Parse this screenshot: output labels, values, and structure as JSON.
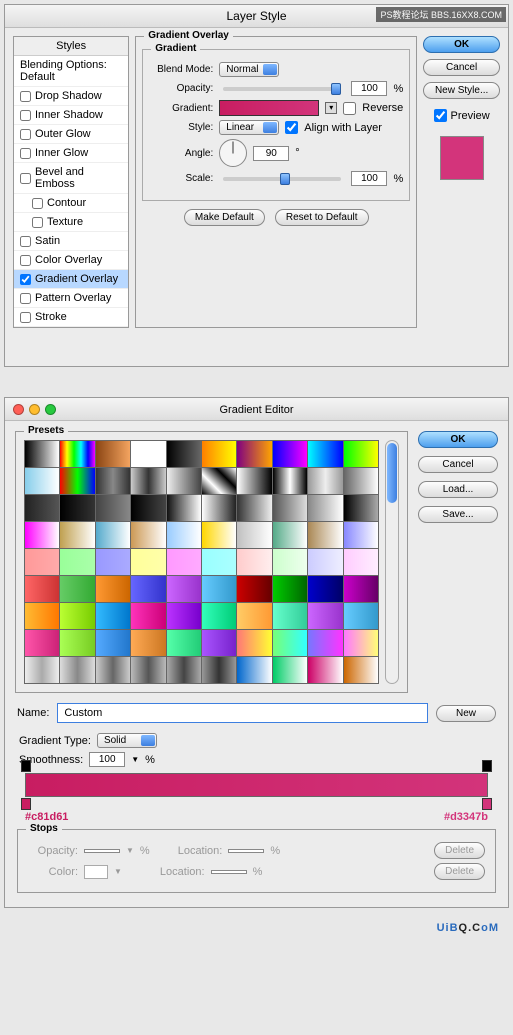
{
  "watermark": "PS教程论坛\nBBS.16XX8.COM",
  "dialog1": {
    "title": "Layer Style",
    "styles_header": "Styles",
    "blending_header": "Blending Options: Default",
    "items": [
      {
        "label": "Drop Shadow",
        "checked": false,
        "sel": false
      },
      {
        "label": "Inner Shadow",
        "checked": false,
        "sel": false
      },
      {
        "label": "Outer Glow",
        "checked": false,
        "sel": false
      },
      {
        "label": "Inner Glow",
        "checked": false,
        "sel": false
      },
      {
        "label": "Bevel and Emboss",
        "checked": false,
        "sel": false
      },
      {
        "label": "Contour",
        "checked": false,
        "sel": false,
        "sub": true
      },
      {
        "label": "Texture",
        "checked": false,
        "sel": false,
        "sub": true
      },
      {
        "label": "Satin",
        "checked": false,
        "sel": false
      },
      {
        "label": "Color Overlay",
        "checked": false,
        "sel": false
      },
      {
        "label": "Gradient Overlay",
        "checked": true,
        "sel": true
      },
      {
        "label": "Pattern Overlay",
        "checked": false,
        "sel": false
      },
      {
        "label": "Stroke",
        "checked": false,
        "sel": false
      }
    ],
    "group_title": "Gradient Overlay",
    "inner_title": "Gradient",
    "blend_mode_label": "Blend Mode:",
    "blend_mode": "Normal",
    "opacity_label": "Opacity:",
    "opacity": "100",
    "pct": "%",
    "gradient_label": "Gradient:",
    "reverse_label": "Reverse",
    "reverse": false,
    "style_label": "Style:",
    "style": "Linear",
    "align_label": "Align with Layer",
    "align": true,
    "angle_label": "Angle:",
    "angle": "90",
    "deg": "°",
    "scale_label": "Scale:",
    "scale": "100",
    "make_default": "Make Default",
    "reset_default": "Reset to Default",
    "ok": "OK",
    "cancel": "Cancel",
    "new_style": "New Style...",
    "preview_label": "Preview",
    "preview": true
  },
  "dialog2": {
    "title": "Gradient Editor",
    "presets_label": "Presets",
    "ok": "OK",
    "cancel": "Cancel",
    "load": "Load...",
    "save": "Save...",
    "name_label": "Name:",
    "name": "Custom",
    "new": "New",
    "grad_type_label": "Gradient Type:",
    "grad_type": "Solid",
    "smooth_label": "Smoothness:",
    "smooth": "100",
    "pct": "%",
    "hex_left": "#c81d61",
    "hex_right": "#d3347b",
    "stops_label": "Stops",
    "opacity_label": "Opacity:",
    "color_label": "Color:",
    "location_label": "Location:",
    "delete": "Delete",
    "preset_colors": [
      "linear-gradient(90deg,#000,#fff)",
      "linear-gradient(90deg,#ff0000,#ffff00,#00ff00,#00ffff,#0000ff,#ff00ff)",
      "linear-gradient(90deg,#8B4513,#F4A460)",
      "linear-gradient(90deg,#fff,#fff)",
      "linear-gradient(90deg,#000,transparent)",
      "linear-gradient(90deg,#ff7f00,#ffff00)",
      "linear-gradient(90deg,#800080,#ffa500)",
      "linear-gradient(90deg,#00f,#f0f)",
      "linear-gradient(90deg,#0ff,#00f)",
      "linear-gradient(90deg,#0f0,#ff0)",
      "linear-gradient(90deg,#87ceeb,#fff)",
      "linear-gradient(90deg,#f00,#0f0,#00f)",
      "linear-gradient(90deg,#333,#888,#333)",
      "linear-gradient(90deg,#ccc,#333,#ccc)",
      "linear-gradient(90deg,#eee,#444)",
      "linear-gradient(45deg,#000,#fff,#000,#fff)",
      "linear-gradient(90deg,#fff,#000)",
      "linear-gradient(90deg,#000,#fff,#000)",
      "linear-gradient(90deg,#999,#eee,#999)",
      "linear-gradient(90deg,#666,#fff)",
      "linear-gradient(90deg,#222,#555)",
      "linear-gradient(90deg,#000,#333)",
      "linear-gradient(90deg,#444,#888)",
      "linear-gradient(90deg,#000,#444)",
      "linear-gradient(90deg,#111,#fff)",
      "linear-gradient(90deg,#fff,#222)",
      "linear-gradient(90deg,#333,#eee)",
      "linear-gradient(90deg,#555,#ddd)",
      "linear-gradient(90deg,#888,#fff)",
      "linear-gradient(90deg,#000,#aaa)",
      "linear-gradient(90deg,#f0f,#fff)",
      "linear-gradient(90deg,#c0a050,#fff)",
      "linear-gradient(90deg,#5ac,#fff)",
      "linear-gradient(90deg,#c95,#fff)",
      "linear-gradient(90deg,#9cf,#fff)",
      "linear-gradient(90deg,#ffd700,#fff)",
      "linear-gradient(90deg,#c0c0c0,#fff)",
      "linear-gradient(90deg,#5a8,#fff)",
      "linear-gradient(90deg,#a85,#fff)",
      "linear-gradient(90deg,#88f,#fff)",
      "linear-gradient(90deg,#f99,#faa)",
      "linear-gradient(90deg,#9f9,#afa)",
      "linear-gradient(90deg,#99f,#aaf)",
      "linear-gradient(90deg,#ff9,#ffa)",
      "linear-gradient(90deg,#f9f,#faf)",
      "linear-gradient(90deg,#9ff,#aff)",
      "linear-gradient(90deg,#fcc,#fee)",
      "linear-gradient(90deg,#cfc,#efe)",
      "linear-gradient(90deg,#ccf,#eef)",
      "linear-gradient(90deg,#fcf,#fef)",
      "linear-gradient(90deg,#f66,#c33)",
      "linear-gradient(90deg,#6c6,#3a3)",
      "linear-gradient(90deg,#f93,#c60)",
      "linear-gradient(90deg,#66f,#33c)",
      "linear-gradient(90deg,#c6f,#93c)",
      "linear-gradient(90deg,#6cf,#39c)",
      "linear-gradient(90deg,#c00,#600)",
      "linear-gradient(90deg,#0c0,#060)",
      "linear-gradient(90deg,#00c,#006)",
      "linear-gradient(90deg,#c0c,#606)",
      "linear-gradient(90deg,#fb3,#f70)",
      "linear-gradient(90deg,#bf3,#7c0)",
      "linear-gradient(90deg,#3bf,#07c)",
      "linear-gradient(90deg,#f3b,#c07)",
      "linear-gradient(90deg,#b3f,#70c)",
      "linear-gradient(90deg,#3fb,#0c7)",
      "linear-gradient(90deg,#fc6,#f93)",
      "linear-gradient(90deg,#6fc,#3c9)",
      "linear-gradient(90deg,#c6f,#93c)",
      "linear-gradient(90deg,#6cf,#39c)",
      "linear-gradient(90deg,#f5a,#c27)",
      "linear-gradient(90deg,#af5,#7c2)",
      "linear-gradient(90deg,#5af,#27c)",
      "linear-gradient(90deg,#fa5,#c72)",
      "linear-gradient(90deg,#5fa,#2c7)",
      "linear-gradient(90deg,#a5f,#72c)",
      "linear-gradient(90deg,#f77,#ff3)",
      "linear-gradient(90deg,#7f7,#3ff)",
      "linear-gradient(90deg,#77f,#f3f)",
      "linear-gradient(90deg,#f7f,#ff7)",
      "linear-gradient(90deg,#eee,#aaa,#eee)",
      "linear-gradient(90deg,#ddd,#888,#ddd)",
      "linear-gradient(90deg,#ccc,#666,#ccc)",
      "linear-gradient(90deg,#bbb,#555,#bbb)",
      "linear-gradient(90deg,#aaa,#444,#aaa)",
      "linear-gradient(90deg,#999,#333,#999)",
      "linear-gradient(90deg,#06c,#fff)",
      "linear-gradient(90deg,#0c6,#fff)",
      "linear-gradient(90deg,#c06,#fff)",
      "linear-gradient(90deg,#c60,#fff)"
    ]
  },
  "footer": {
    "t1": "UiB",
    "t2": "Q.C",
    "t3": "oM"
  }
}
